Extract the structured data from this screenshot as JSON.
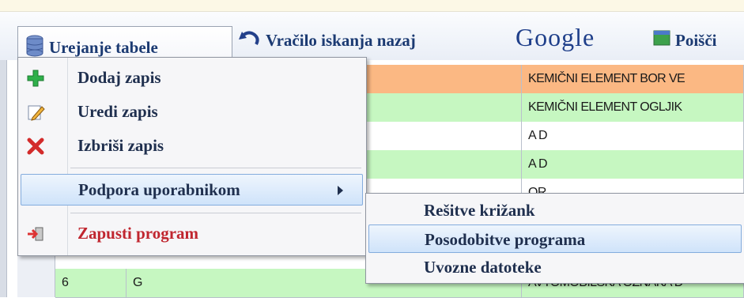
{
  "toolbar": {
    "menu_label": "Urejanje tabele",
    "back_label": "Vračilo iskanja nazaj",
    "google_label": "Google",
    "search_label": "Poišči"
  },
  "grid_rows": [
    {
      "c1": "",
      "c2": "",
      "c3": "KEMIČNI ELEMENT BOR VE",
      "color": "#fbb883"
    },
    {
      "c1": "",
      "c2": "",
      "c3": "KEMIČNI ELEMENT OGLJIK",
      "color": "#c6f7c1"
    },
    {
      "c1": "",
      "c2": "",
      "c3": "A D",
      "color": "#ffffff"
    },
    {
      "c1": "",
      "c2": "",
      "c3": "A D",
      "color": "#c6f7c1"
    },
    {
      "c1": "",
      "c2": "",
      "c3": "OR",
      "color": "#ffffff"
    },
    {
      "c1": "6",
      "c2": "G",
      "c3": "AVTOMOBILSKA OZNAKA D",
      "color": "#c6f7c1"
    }
  ],
  "menu": {
    "items": [
      {
        "label": "Dodaj zapis",
        "icon": "plus-icon"
      },
      {
        "label": "Uredi zapis",
        "icon": "pencil-icon"
      },
      {
        "label": "Izbriši zapis",
        "icon": "delete-x-icon"
      },
      {
        "label": "Podpora uporabnikom",
        "icon": ""
      },
      {
        "label": "Zapusti program",
        "icon": "exit-icon"
      }
    ]
  },
  "submenu": {
    "items": [
      {
        "label": "Rešitve križank"
      },
      {
        "label": "Posodobitve programa"
      },
      {
        "label": "Uvozne datoteke"
      }
    ]
  },
  "colors": {
    "highlight": "#cfe3fa",
    "row_orange": "#fbb883",
    "row_green": "#c6f7c1",
    "exit_red": "#c0262f"
  }
}
